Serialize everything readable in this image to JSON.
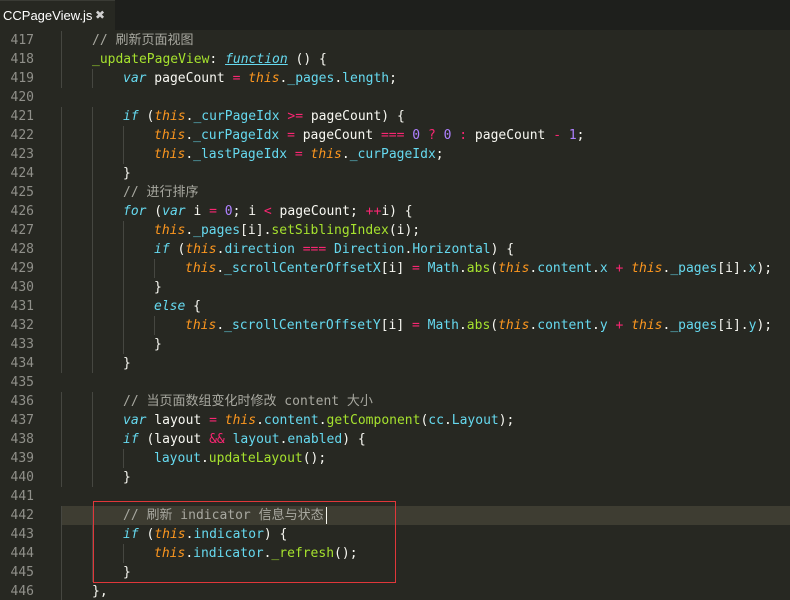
{
  "tab": {
    "title": "CCPageView.js",
    "close_glyph": "✖"
  },
  "editor": {
    "current_line": 442,
    "lines": [
      {
        "n": "417",
        "indent": 1,
        "tokens": [
          [
            "cm",
            "// 刷新页面视图"
          ]
        ]
      },
      {
        "n": "418",
        "indent": 1,
        "tokens": [
          [
            "def",
            "_updatePageView"
          ],
          [
            "plain",
            ": "
          ],
          [
            "deffn",
            "function"
          ],
          [
            "plain",
            " () {"
          ]
        ]
      },
      {
        "n": "419",
        "indent": 2,
        "tokens": [
          [
            "kw",
            "var"
          ],
          [
            "plain",
            " pageCount "
          ],
          [
            "op",
            "="
          ],
          [
            "plain",
            " "
          ],
          [
            "this",
            "this"
          ],
          [
            "plain",
            "."
          ],
          [
            "prop",
            "_pages"
          ],
          [
            "plain",
            "."
          ],
          [
            "prop",
            "length"
          ],
          [
            "plain",
            ";"
          ]
        ]
      },
      {
        "n": "420",
        "indent": 0,
        "tokens": []
      },
      {
        "n": "421",
        "indent": 2,
        "tokens": [
          [
            "kw",
            "if"
          ],
          [
            "plain",
            " ("
          ],
          [
            "this",
            "this"
          ],
          [
            "plain",
            "."
          ],
          [
            "prop",
            "_curPageIdx"
          ],
          [
            "plain",
            " "
          ],
          [
            "op",
            ">="
          ],
          [
            "plain",
            " pageCount) {"
          ]
        ]
      },
      {
        "n": "422",
        "indent": 3,
        "tokens": [
          [
            "this",
            "this"
          ],
          [
            "plain",
            "."
          ],
          [
            "prop",
            "_curPageIdx"
          ],
          [
            "plain",
            " "
          ],
          [
            "op",
            "="
          ],
          [
            "plain",
            " pageCount "
          ],
          [
            "op",
            "==="
          ],
          [
            "plain",
            " "
          ],
          [
            "num",
            "0"
          ],
          [
            "plain",
            " "
          ],
          [
            "op",
            "?"
          ],
          [
            "plain",
            " "
          ],
          [
            "num",
            "0"
          ],
          [
            "plain",
            " "
          ],
          [
            "op",
            ":"
          ],
          [
            "plain",
            " pageCount "
          ],
          [
            "op",
            "-"
          ],
          [
            "plain",
            " "
          ],
          [
            "num",
            "1"
          ],
          [
            "plain",
            ";"
          ]
        ]
      },
      {
        "n": "423",
        "indent": 3,
        "tokens": [
          [
            "this",
            "this"
          ],
          [
            "plain",
            "."
          ],
          [
            "prop",
            "_lastPageIdx"
          ],
          [
            "plain",
            " "
          ],
          [
            "op",
            "="
          ],
          [
            "plain",
            " "
          ],
          [
            "this",
            "this"
          ],
          [
            "plain",
            "."
          ],
          [
            "prop",
            "_curPageIdx"
          ],
          [
            "plain",
            ";"
          ]
        ]
      },
      {
        "n": "424",
        "indent": 2,
        "tokens": [
          [
            "plain",
            "}"
          ]
        ]
      },
      {
        "n": "425",
        "indent": 2,
        "tokens": [
          [
            "cm",
            "// 进行排序"
          ]
        ]
      },
      {
        "n": "426",
        "indent": 2,
        "tokens": [
          [
            "kw",
            "for"
          ],
          [
            "plain",
            " ("
          ],
          [
            "kw",
            "var"
          ],
          [
            "plain",
            " i "
          ],
          [
            "op",
            "="
          ],
          [
            "plain",
            " "
          ],
          [
            "num",
            "0"
          ],
          [
            "plain",
            "; i "
          ],
          [
            "op",
            "<"
          ],
          [
            "plain",
            " pageCount; "
          ],
          [
            "op",
            "++"
          ],
          [
            "plain",
            "i) {"
          ]
        ]
      },
      {
        "n": "427",
        "indent": 3,
        "tokens": [
          [
            "this",
            "this"
          ],
          [
            "plain",
            "."
          ],
          [
            "prop",
            "_pages"
          ],
          [
            "plain",
            "[i]."
          ],
          [
            "fn",
            "setSiblingIndex"
          ],
          [
            "plain",
            "(i);"
          ]
        ]
      },
      {
        "n": "428",
        "indent": 3,
        "tokens": [
          [
            "kw",
            "if"
          ],
          [
            "plain",
            " ("
          ],
          [
            "this",
            "this"
          ],
          [
            "plain",
            "."
          ],
          [
            "prop",
            "direction"
          ],
          [
            "plain",
            " "
          ],
          [
            "op",
            "==="
          ],
          [
            "plain",
            " "
          ],
          [
            "cls",
            "Direction"
          ],
          [
            "plain",
            "."
          ],
          [
            "prop",
            "Horizontal"
          ],
          [
            "plain",
            ") {"
          ]
        ]
      },
      {
        "n": "429",
        "indent": 4,
        "tokens": [
          [
            "this",
            "this"
          ],
          [
            "plain",
            "."
          ],
          [
            "prop",
            "_scrollCenterOffsetX"
          ],
          [
            "plain",
            "[i] "
          ],
          [
            "op",
            "="
          ],
          [
            "plain",
            " "
          ],
          [
            "cls",
            "Math"
          ],
          [
            "plain",
            "."
          ],
          [
            "fn",
            "abs"
          ],
          [
            "plain",
            "("
          ],
          [
            "this",
            "this"
          ],
          [
            "plain",
            "."
          ],
          [
            "prop",
            "content"
          ],
          [
            "plain",
            "."
          ],
          [
            "prop",
            "x"
          ],
          [
            "plain",
            " "
          ],
          [
            "op",
            "+"
          ],
          [
            "plain",
            " "
          ],
          [
            "this",
            "this"
          ],
          [
            "plain",
            "."
          ],
          [
            "prop",
            "_pages"
          ],
          [
            "plain",
            "[i]."
          ],
          [
            "prop",
            "x"
          ],
          [
            "plain",
            ");"
          ]
        ]
      },
      {
        "n": "430",
        "indent": 3,
        "tokens": [
          [
            "plain",
            "}"
          ]
        ]
      },
      {
        "n": "431",
        "indent": 3,
        "tokens": [
          [
            "kw",
            "else"
          ],
          [
            "plain",
            " {"
          ]
        ]
      },
      {
        "n": "432",
        "indent": 4,
        "tokens": [
          [
            "this",
            "this"
          ],
          [
            "plain",
            "."
          ],
          [
            "prop",
            "_scrollCenterOffsetY"
          ],
          [
            "plain",
            "[i] "
          ],
          [
            "op",
            "="
          ],
          [
            "plain",
            " "
          ],
          [
            "cls",
            "Math"
          ],
          [
            "plain",
            "."
          ],
          [
            "fn",
            "abs"
          ],
          [
            "plain",
            "("
          ],
          [
            "this",
            "this"
          ],
          [
            "plain",
            "."
          ],
          [
            "prop",
            "content"
          ],
          [
            "plain",
            "."
          ],
          [
            "prop",
            "y"
          ],
          [
            "plain",
            " "
          ],
          [
            "op",
            "+"
          ],
          [
            "plain",
            " "
          ],
          [
            "this",
            "this"
          ],
          [
            "plain",
            "."
          ],
          [
            "prop",
            "_pages"
          ],
          [
            "plain",
            "[i]."
          ],
          [
            "prop",
            "y"
          ],
          [
            "plain",
            ");"
          ]
        ]
      },
      {
        "n": "433",
        "indent": 3,
        "tokens": [
          [
            "plain",
            "}"
          ]
        ]
      },
      {
        "n": "434",
        "indent": 2,
        "tokens": [
          [
            "plain",
            "}"
          ]
        ]
      },
      {
        "n": "435",
        "indent": 0,
        "tokens": []
      },
      {
        "n": "436",
        "indent": 2,
        "tokens": [
          [
            "cm",
            "// 当页面数组变化时修改 content 大小"
          ]
        ]
      },
      {
        "n": "437",
        "indent": 2,
        "tokens": [
          [
            "kw",
            "var"
          ],
          [
            "plain",
            " layout "
          ],
          [
            "op",
            "="
          ],
          [
            "plain",
            " "
          ],
          [
            "this",
            "this"
          ],
          [
            "plain",
            "."
          ],
          [
            "prop",
            "content"
          ],
          [
            "plain",
            "."
          ],
          [
            "fn",
            "getComponent"
          ],
          [
            "plain",
            "("
          ],
          [
            "prop",
            "cc"
          ],
          [
            "plain",
            "."
          ],
          [
            "prop",
            "Layout"
          ],
          [
            "plain",
            ");"
          ]
        ]
      },
      {
        "n": "438",
        "indent": 2,
        "tokens": [
          [
            "kw",
            "if"
          ],
          [
            "plain",
            " (layout "
          ],
          [
            "op",
            "&&"
          ],
          [
            "plain",
            " "
          ],
          [
            "prop",
            "layout"
          ],
          [
            "plain",
            "."
          ],
          [
            "prop",
            "enabled"
          ],
          [
            "plain",
            ") {"
          ]
        ]
      },
      {
        "n": "439",
        "indent": 3,
        "tokens": [
          [
            "prop",
            "layout"
          ],
          [
            "plain",
            "."
          ],
          [
            "fn",
            "updateLayout"
          ],
          [
            "plain",
            "();"
          ]
        ]
      },
      {
        "n": "440",
        "indent": 2,
        "tokens": [
          [
            "plain",
            "}"
          ]
        ]
      },
      {
        "n": "441",
        "indent": 0,
        "tokens": []
      },
      {
        "n": "442",
        "indent": 2,
        "tokens": [
          [
            "cm",
            "// 刷新 indicator 信息与状态"
          ]
        ]
      },
      {
        "n": "443",
        "indent": 2,
        "tokens": [
          [
            "kw",
            "if"
          ],
          [
            "plain",
            " ("
          ],
          [
            "this",
            "this"
          ],
          [
            "plain",
            "."
          ],
          [
            "prop",
            "indicator"
          ],
          [
            "plain",
            ") {"
          ]
        ]
      },
      {
        "n": "444",
        "indent": 3,
        "tokens": [
          [
            "this",
            "this"
          ],
          [
            "plain",
            "."
          ],
          [
            "prop",
            "indicator"
          ],
          [
            "plain",
            "."
          ],
          [
            "fn",
            "_refresh"
          ],
          [
            "plain",
            "();"
          ]
        ]
      },
      {
        "n": "445",
        "indent": 2,
        "tokens": [
          [
            "plain",
            "}"
          ]
        ]
      },
      {
        "n": "446",
        "indent": 1,
        "tokens": [
          [
            "plain",
            "},"
          ]
        ]
      }
    ]
  }
}
